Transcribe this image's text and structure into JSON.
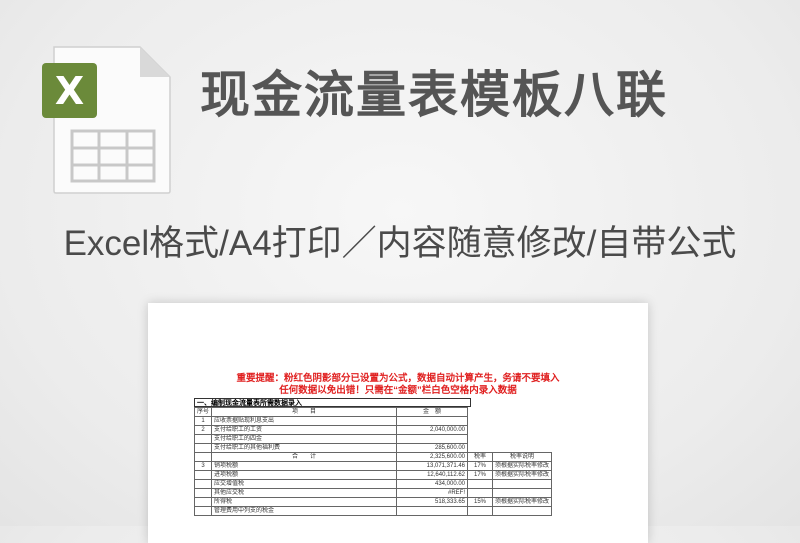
{
  "header": {
    "title": "现金流量表模板八联",
    "subtitle": "Excel格式/A4打印／内容随意修改/自带公式"
  },
  "icon": {
    "name": "excel-file-icon",
    "letter": "X",
    "accent": "#6b8a3a"
  },
  "sheet": {
    "notice_line1": "重要提醒：粉红色阴影部分已设置为公式，数据自动计算产生，务请不要填入",
    "notice_line2": "任何数据以免出错！只需在“金额”栏白色空格内录入数据",
    "section_title": "一、编制现金流量表所需数据录入",
    "col_headers": {
      "no": "序号",
      "item": "项　　目",
      "amount": "金　额",
      "tax_rate": "税率",
      "tax_note": "税率说明"
    },
    "rows": [
      {
        "no": "1",
        "item": "应收票据贴现利息支出",
        "amount": ""
      },
      {
        "no": "2",
        "item": "支付给职工的工资",
        "amount": "2,040,000.00"
      },
      {
        "no": "",
        "item": "支付给职工的四金",
        "amount": ""
      },
      {
        "no": "",
        "item": "支付给职工的其他福利费",
        "amount": "285,600.00"
      }
    ],
    "total_row": {
      "label": "合　　计",
      "amount": "2,325,600.00",
      "tax_rate": "税率",
      "tax_note": "税率说明"
    },
    "tax_rows": [
      {
        "no": "3",
        "item": "销项税额",
        "amount": "13,071,371.46",
        "tax_rate": "17%",
        "tax_note": "须根据实际税率修改"
      },
      {
        "no": "",
        "item": "进项税额",
        "amount": "12,640,112.62",
        "tax_rate": "17%",
        "tax_note": "须根据实际税率修改"
      },
      {
        "no": "",
        "item": "应交增值税",
        "amount": "434,000.00",
        "tax_rate": "",
        "tax_note": ""
      },
      {
        "no": "",
        "item": "其他应交税",
        "amount": "#REF!",
        "tax_rate": "",
        "tax_note": ""
      },
      {
        "no": "",
        "item": "所得税",
        "amount": "518,333.65",
        "tax_rate": "15%",
        "tax_note": "须根据实际税率修改"
      },
      {
        "no": "",
        "item": "管理费用中列支的税金",
        "amount": "",
        "tax_rate": "",
        "tax_note": ""
      }
    ]
  }
}
